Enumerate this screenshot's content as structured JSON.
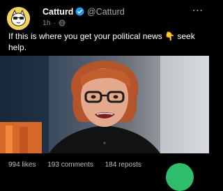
{
  "post": {
    "author_name": "Catturd",
    "handle": "@Catturd",
    "time": "1h",
    "separator": "·",
    "text": "If this is where you get your political news 👇 seek help."
  },
  "stats": {
    "likes": "994 likes",
    "comments": "193 comments",
    "reposts": "184 reposts"
  },
  "icons": {
    "avatar": "cat-avatar-icon",
    "verified": "verified-badge-icon",
    "visibility": "globe-icon",
    "more": "more-options-icon",
    "fab": "compose-button"
  },
  "colors": {
    "background": "#000000",
    "verified": "#1d9bf0",
    "fab": "#2ebd6b",
    "avatar_bg": "#f3d35a"
  }
}
